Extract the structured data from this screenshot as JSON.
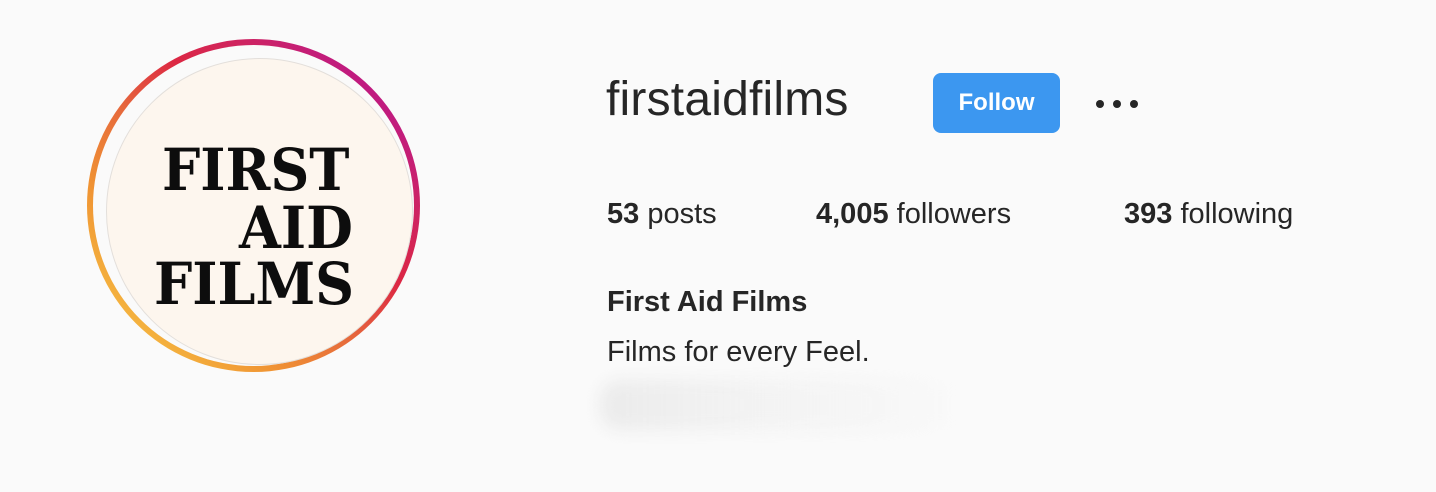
{
  "profile": {
    "username": "firstaidfilms",
    "follow_label": "Follow",
    "more_options_icon": "more-horizontal-icon",
    "avatar": {
      "logo_lines": [
        "FIRST",
        "AID",
        "FILMS"
      ],
      "ring_colors": [
        "#f8d24a",
        "#f09433",
        "#dc2743",
        "#bc1888",
        "#a12ec2"
      ],
      "background_color": "#fdf6ee"
    },
    "stats": {
      "posts": {
        "count": "53",
        "label": "posts"
      },
      "followers": {
        "count": "4,005",
        "label": "followers"
      },
      "following": {
        "count": "393",
        "label": "following"
      }
    },
    "full_name": "First Aid Films",
    "bio": "Films for every Feel."
  },
  "colors": {
    "accent": "#3c97f0",
    "text": "#262626",
    "background": "#fafafa"
  }
}
